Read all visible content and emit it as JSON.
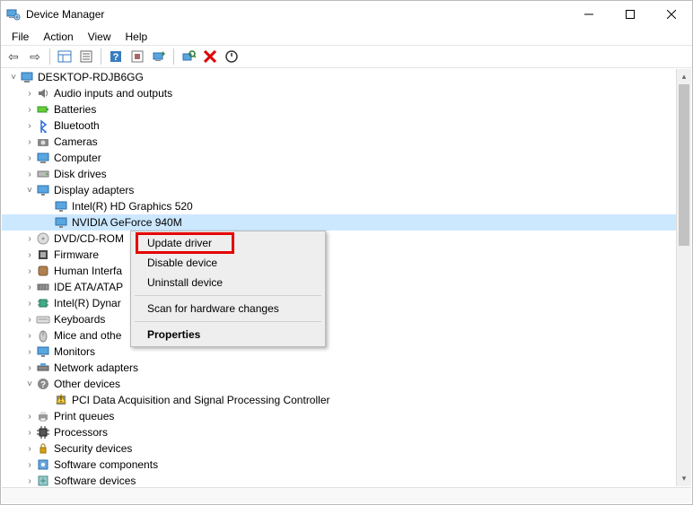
{
  "window": {
    "title": "Device Manager"
  },
  "menus": {
    "file": "File",
    "action": "Action",
    "view": "View",
    "help": "Help"
  },
  "root": {
    "name": "DESKTOP-RDJB6GG"
  },
  "categories": [
    {
      "id": "audio",
      "label": "Audio inputs and outputs",
      "expanded": false,
      "icon": "speaker"
    },
    {
      "id": "batteries",
      "label": "Batteries",
      "expanded": false,
      "icon": "battery"
    },
    {
      "id": "bluetooth",
      "label": "Bluetooth",
      "expanded": false,
      "icon": "bluetooth"
    },
    {
      "id": "cameras",
      "label": "Cameras",
      "expanded": false,
      "icon": "camera"
    },
    {
      "id": "computer",
      "label": "Computer",
      "expanded": false,
      "icon": "computer"
    },
    {
      "id": "disk",
      "label": "Disk drives",
      "expanded": false,
      "icon": "disk"
    },
    {
      "id": "display",
      "label": "Display adapters",
      "expanded": true,
      "icon": "display",
      "children": [
        {
          "id": "intel",
          "label": "Intel(R) HD Graphics 520",
          "icon": "display",
          "selected": false
        },
        {
          "id": "nvidia",
          "label": "NVIDIA GeForce 940M",
          "icon": "display",
          "selected": true
        }
      ]
    },
    {
      "id": "dvd",
      "label": "DVD/CD-ROM",
      "truncated": true,
      "expanded": false,
      "icon": "optical"
    },
    {
      "id": "firmware",
      "label": "Firmware",
      "expanded": false,
      "icon": "firmware"
    },
    {
      "id": "hid",
      "label": "Human Interfa",
      "truncated": true,
      "expanded": false,
      "icon": "hid"
    },
    {
      "id": "ide",
      "label": "IDE ATA/ATAP",
      "truncated": true,
      "expanded": false,
      "icon": "ide"
    },
    {
      "id": "intel-dyn",
      "label": "Intel(R) Dynar",
      "truncated": true,
      "expanded": false,
      "icon": "chip"
    },
    {
      "id": "keyboards",
      "label": "Keyboards",
      "expanded": false,
      "icon": "keyboard"
    },
    {
      "id": "mice",
      "label": "Mice and othe",
      "truncated": true,
      "expanded": false,
      "icon": "mouse"
    },
    {
      "id": "monitors",
      "label": "Monitors",
      "expanded": false,
      "icon": "monitor"
    },
    {
      "id": "network",
      "label": "Network adapters",
      "expanded": false,
      "icon": "network"
    },
    {
      "id": "other",
      "label": "Other devices",
      "expanded": true,
      "icon": "other",
      "children": [
        {
          "id": "pci-daq",
          "label": "PCI Data Acquisition and Signal Processing Controller",
          "icon": "warning"
        }
      ]
    },
    {
      "id": "printq",
      "label": "Print queues",
      "expanded": false,
      "icon": "printer"
    },
    {
      "id": "processors",
      "label": "Processors",
      "expanded": false,
      "icon": "cpu"
    },
    {
      "id": "security",
      "label": "Security devices",
      "expanded": false,
      "icon": "security"
    },
    {
      "id": "swcomp",
      "label": "Software components",
      "expanded": false,
      "icon": "swcomp"
    },
    {
      "id": "swdev",
      "label": "Software devices",
      "expanded": false,
      "icon": "swdev"
    }
  ],
  "context_menu": {
    "update": "Update driver",
    "disable": "Disable device",
    "uninstall": "Uninstall device",
    "scan": "Scan for hardware changes",
    "props": "Properties"
  }
}
